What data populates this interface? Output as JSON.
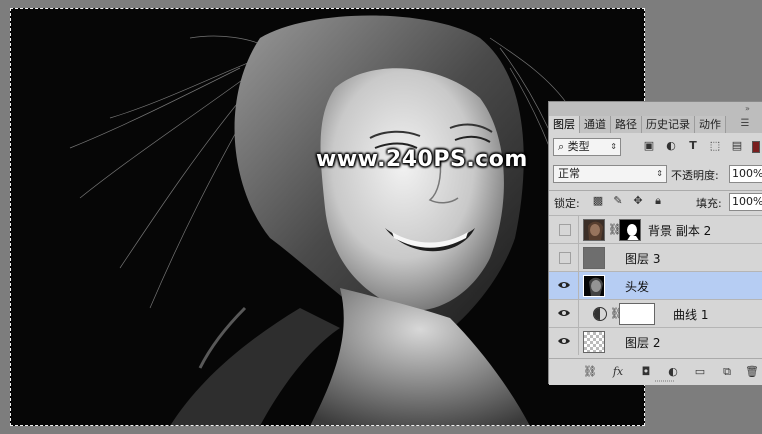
{
  "document": {
    "watermark": "www.240PS.com"
  },
  "layers_panel": {
    "tabs": [
      {
        "label": "图层",
        "active": true
      },
      {
        "label": "通道",
        "active": false
      },
      {
        "label": "路径",
        "active": false
      },
      {
        "label": "历史记录",
        "active": false
      },
      {
        "label": "动作",
        "active": false
      }
    ],
    "filter": {
      "kind": "类型"
    },
    "blend_mode": "正常",
    "opacity_label": "不透明度:",
    "opacity_value": "100%",
    "lock_label": "锁定:",
    "fill_label": "填充:",
    "fill_value": "100%",
    "layers": [
      {
        "name": "背景 副本 2",
        "visible": false,
        "selected": false,
        "thumb": "photo",
        "has_mask": true
      },
      {
        "name": "图层 3",
        "visible": false,
        "selected": false,
        "thumb": "gray"
      },
      {
        "name": "头发",
        "visible": true,
        "selected": true,
        "thumb": "bw-photo"
      },
      {
        "name": "曲线 1",
        "visible": true,
        "selected": false,
        "thumb": "adjustment",
        "has_mask": true
      },
      {
        "name": "图层 2",
        "visible": true,
        "selected": false,
        "thumb": "transparent"
      }
    ],
    "footer_icons": [
      "link-icon",
      "fx-icon",
      "mask-icon",
      "adjustment-icon",
      "folder-icon",
      "new-layer-icon",
      "trash-icon"
    ],
    "colors": {
      "panel_bg": "#d6d6d6",
      "selected_row": "#b6cdf3",
      "canvas_bg": "#7d7d7d"
    }
  }
}
